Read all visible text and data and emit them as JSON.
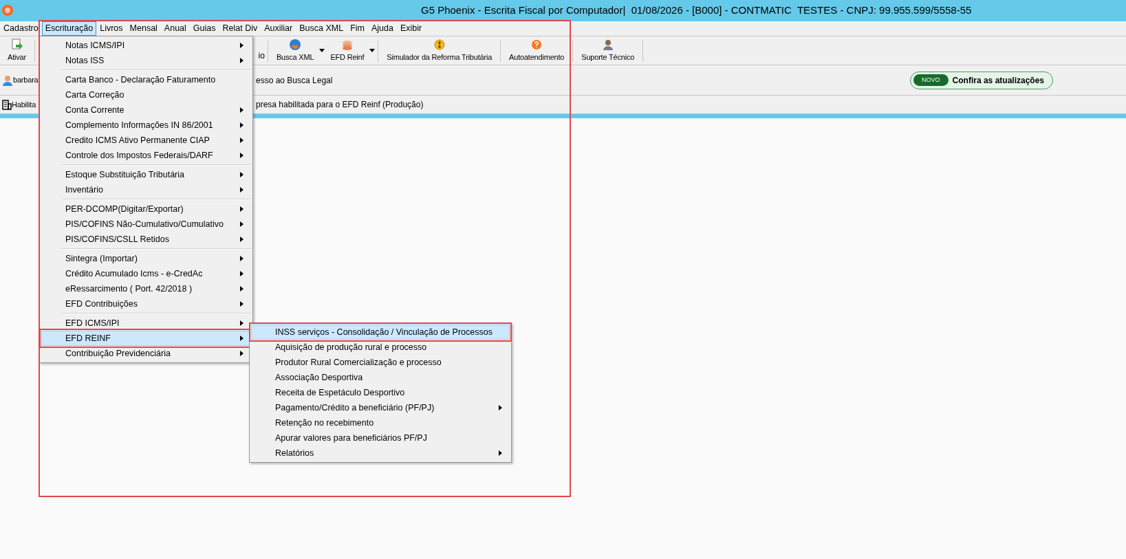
{
  "window": {
    "title": "G5 Phoenix - Escrita Fiscal por Computador|  01/08/2026 - [B000] - CONTMATIC  TESTES - CNPJ: 99.955.599/5558-55"
  },
  "menu_bar": [
    {
      "label": "Cadastro",
      "selected": false
    },
    {
      "label": "Escrituração",
      "selected": true
    },
    {
      "label": "Livros",
      "selected": false
    },
    {
      "label": "Mensal",
      "selected": false
    },
    {
      "label": "Anual",
      "selected": false
    },
    {
      "label": "Guias",
      "selected": false
    },
    {
      "label": "Relat Div",
      "selected": false
    },
    {
      "label": "Auxiliar",
      "selected": false
    },
    {
      "label": "Busca XML",
      "selected": false
    },
    {
      "label": "Fim",
      "selected": false
    },
    {
      "label": "Ajuda",
      "selected": false
    },
    {
      "label": "Exibir",
      "selected": false
    }
  ],
  "toolbar": [
    {
      "label": "Ativar",
      "kind": "button"
    },
    {
      "label": "io",
      "kind": "partial"
    },
    {
      "label": "Busca XML",
      "kind": "dropdown"
    },
    {
      "label": "EFD Reinf",
      "kind": "dropdown"
    },
    {
      "label": "Simulador da Reforma Tributária",
      "kind": "button"
    },
    {
      "label": "Autoatendimento",
      "kind": "button"
    },
    {
      "label": "Suporte Técnico",
      "kind": "button"
    }
  ],
  "user_row": {
    "user": "barbara",
    "notice": "esso ao Busca Legal",
    "badge": "NOVO",
    "link": "Confira as atualizações"
  },
  "status_row": {
    "label": "Habilita",
    "notice": "presa habilitada para o EFD Reinf (Produção)"
  },
  "menu": {
    "groups": [
      [
        {
          "label": "Notas ICMS/IPI",
          "submenu": true,
          "selected": false,
          "marked": false
        },
        {
          "label": "Notas ISS",
          "submenu": true,
          "selected": false,
          "marked": false
        }
      ],
      [
        {
          "label": "Carta Banco - Declaração Faturamento",
          "submenu": false,
          "selected": false,
          "marked": false
        },
        {
          "label": "Carta Correção",
          "submenu": false,
          "selected": false,
          "marked": false
        },
        {
          "label": "Conta Corrente",
          "submenu": true,
          "selected": false,
          "marked": false
        },
        {
          "label": "Complemento Informações IN 86/2001",
          "submenu": true,
          "selected": false,
          "marked": false
        },
        {
          "label": "Credito ICMS Ativo Permanente CIAP",
          "submenu": true,
          "selected": false,
          "marked": false
        },
        {
          "label": "Controle dos Impostos Federais/DARF",
          "submenu": true,
          "selected": false,
          "marked": false
        }
      ],
      [
        {
          "label": "Estoque Substituição Tributária",
          "submenu": true,
          "selected": false,
          "marked": false
        },
        {
          "label": "Inventário",
          "submenu": true,
          "selected": false,
          "marked": false
        }
      ],
      [
        {
          "label": "PER-DCOMP(Digitar/Exportar)",
          "submenu": true,
          "selected": false,
          "marked": false
        },
        {
          "label": "PIS/COFINS Não-Cumulativo/Cumulativo",
          "submenu": true,
          "selected": false,
          "marked": false
        },
        {
          "label": "PIS/COFINS/CSLL Retidos",
          "submenu": true,
          "selected": false,
          "marked": false
        }
      ],
      [
        {
          "label": "Sintegra (Importar)",
          "submenu": true,
          "selected": false,
          "marked": false
        },
        {
          "label": "Crédito Acumulado Icms - e-CredAc",
          "submenu": true,
          "selected": false,
          "marked": false
        },
        {
          "label": "eRessarcimento ( Port. 42/2018 )",
          "submenu": true,
          "selected": false,
          "marked": false
        },
        {
          "label": "EFD Contribuições",
          "submenu": true,
          "selected": false,
          "marked": false
        }
      ],
      [
        {
          "label": "EFD ICMS/IPI",
          "submenu": true,
          "selected": false,
          "marked": false
        },
        {
          "label": "EFD REINF",
          "submenu": true,
          "selected": true,
          "marked": true
        },
        {
          "label": "Contribuição Previdenciária",
          "submenu": true,
          "selected": false,
          "marked": false
        }
      ]
    ]
  },
  "submenu": {
    "items": [
      {
        "label": "INSS serviços - Consolidação / Vinculação de Processos",
        "submenu": false,
        "selected": true,
        "marked": true
      },
      {
        "label": "Aquisição de produção rural e processo",
        "submenu": false,
        "selected": false,
        "marked": false
      },
      {
        "label": "Produtor Rural Comercialização e processo",
        "submenu": false,
        "selected": false,
        "marked": false
      },
      {
        "label": "Associação Desportiva",
        "submenu": false,
        "selected": false,
        "marked": false
      },
      {
        "label": "Receita de Espetáculo Desportivo",
        "submenu": false,
        "selected": false,
        "marked": false
      },
      {
        "label": "Pagamento/Crédito a beneficiário (PF/PJ)",
        "submenu": true,
        "selected": false,
        "marked": false
      },
      {
        "label": "Retenção no recebimento",
        "submenu": false,
        "selected": false,
        "marked": false
      },
      {
        "label": "Apurar valores para beneficiários PF/PJ",
        "submenu": false,
        "selected": false,
        "marked": false
      },
      {
        "label": "Relatórios",
        "submenu": true,
        "selected": false,
        "marked": false
      }
    ]
  }
}
